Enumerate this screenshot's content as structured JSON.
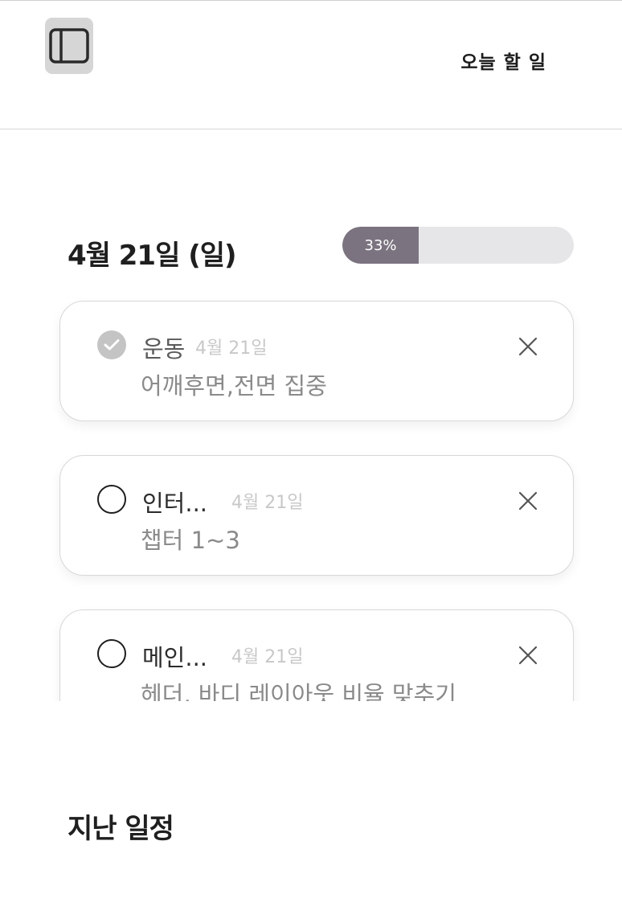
{
  "header": {
    "title": "오늘 할 일"
  },
  "today": {
    "date_heading": "4월 21일 (일)",
    "progress_percent": 33,
    "progress_label": "33%"
  },
  "tasks": [
    {
      "title": "운동",
      "date": "4월 21일",
      "description": "어깨후면,전면 집중",
      "completed": true
    },
    {
      "title": "인터...",
      "date": "4월 21일",
      "description": "챕터 1~3",
      "completed": false
    },
    {
      "title": "메인...",
      "date": "4월 21일",
      "description": "헤더, 바디 레이아웃 비율 맞추기",
      "completed": false
    }
  ],
  "past": {
    "heading": "지난 일정"
  },
  "icons": {
    "sidebar_toggle": "sidebar-panel-icon",
    "check_done": "checkmark-circle-icon",
    "check_empty": "empty-circle-icon",
    "delete": "close-icon"
  },
  "colors": {
    "progress_fill": "#7b7480",
    "progress_track": "#e6e6e8",
    "check_done": "#c4c4c4"
  }
}
